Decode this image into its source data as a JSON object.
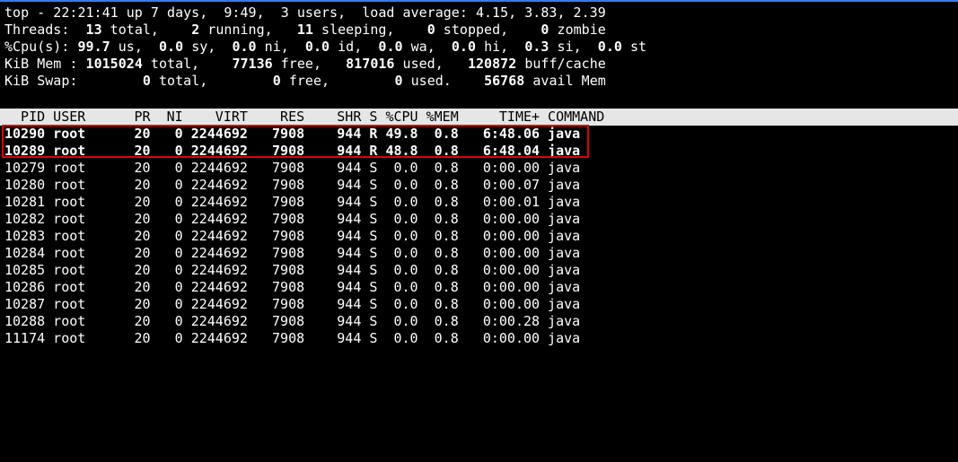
{
  "summary": {
    "line1": "top - 22:21:41 up 7 days,  9:49,  3 users,  load average: 4.15, 3.83, 2.39",
    "threads_label": "Threads: ",
    "threads_total": " 13",
    "threads_total_label": " total,   ",
    "threads_running": " 2",
    "threads_running_label": " running,  ",
    "threads_sleeping": " 11",
    "threads_sleeping_label": " sleeping,   ",
    "threads_stopped": " 0",
    "threads_stopped_label": " stopped,   ",
    "threads_zombie": " 0",
    "threads_zombie_label": " zombie",
    "cpu_label": "%Cpu(s): ",
    "cpu_us": "99.7",
    "cpu_us_label": " us,  ",
    "cpu_sy": "0.0",
    "cpu_sy_label": " sy,  ",
    "cpu_ni": "0.0",
    "cpu_ni_label": " ni,  ",
    "cpu_id": "0.0",
    "cpu_id_label": " id,  ",
    "cpu_wa": "0.0",
    "cpu_wa_label": " wa,  ",
    "cpu_hi": "0.0",
    "cpu_hi_label": " hi,  ",
    "cpu_si": "0.3",
    "cpu_si_label": " si,  ",
    "cpu_st": "0.0",
    "cpu_st_label": " st",
    "mem_label": "KiB Mem : ",
    "mem_total": "1015024",
    "mem_total_label": " total,    ",
    "mem_free": "77136",
    "mem_free_label": " free,   ",
    "mem_used": "817016",
    "mem_used_label": " used,   ",
    "mem_buff": "120872",
    "mem_buff_label": " buff/cache",
    "swap_label": "KiB Swap:        ",
    "swap_total": "0",
    "swap_total_label": " total,        ",
    "swap_free": "0",
    "swap_free_label": " free,        ",
    "swap_used": "0",
    "swap_used_label": " used.    ",
    "swap_avail": "56768",
    "swap_avail_label": " avail Mem"
  },
  "table": {
    "header": "  PID USER      PR  NI    VIRT    RES    SHR S %CPU %MEM     TIME+ COMMAND",
    "rows": [
      "10290 root      20   0 2244692   7908    944 R 49.8  0.8   6:48.06 java",
      "10289 root      20   0 2244692   7908    944 R 48.8  0.8   6:48.04 java",
      "10279 root      20   0 2244692   7908    944 S  0.0  0.8   0:00.00 java",
      "10280 root      20   0 2244692   7908    944 S  0.0  0.8   0:00.07 java",
      "10281 root      20   0 2244692   7908    944 S  0.0  0.8   0:00.01 java",
      "10282 root      20   0 2244692   7908    944 S  0.0  0.8   0:00.00 java",
      "10283 root      20   0 2244692   7908    944 S  0.0  0.8   0:00.00 java",
      "10284 root      20   0 2244692   7908    944 S  0.0  0.8   0:00.00 java",
      "10285 root      20   0 2244692   7908    944 S  0.0  0.8   0:00.00 java",
      "10286 root      20   0 2244692   7908    944 S  0.0  0.8   0:00.00 java",
      "10287 root      20   0 2244692   7908    944 S  0.0  0.8   0:00.00 java",
      "10288 root      20   0 2244692   7908    944 S  0.0  0.8   0:00.28 java",
      "11174 root      20   0 2244692   7908    944 S  0.0  0.8   0:00.00 java"
    ]
  },
  "colors": {
    "background": "#000000",
    "text": "#ffffff",
    "header_bar": "#e6e6e6",
    "highlight_border": "#e00000",
    "top_border": "#3b78e7"
  }
}
